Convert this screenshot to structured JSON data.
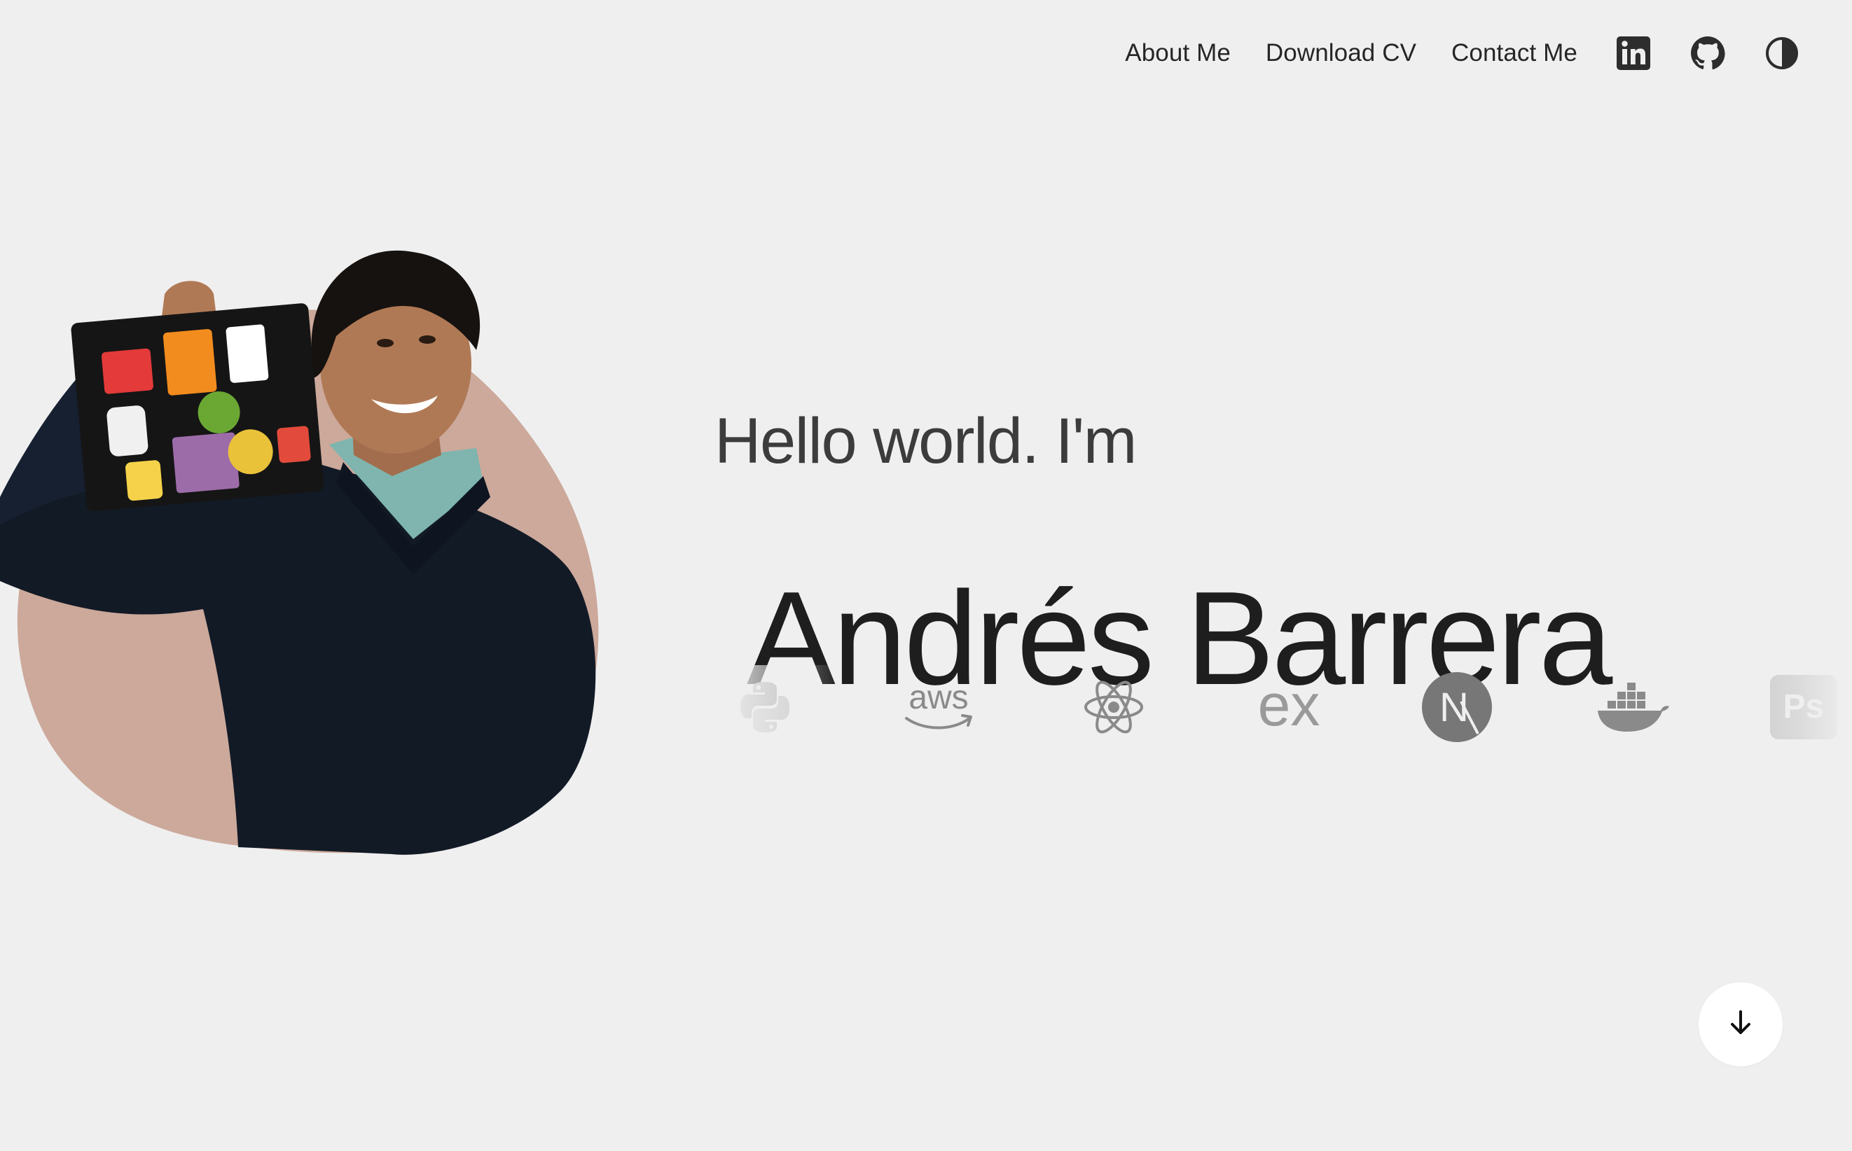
{
  "nav": {
    "links": [
      {
        "label": "About Me"
      },
      {
        "label": "Download CV"
      },
      {
        "label": "Contact Me"
      }
    ],
    "icons": [
      "linkedin-icon",
      "github-icon",
      "theme-toggle-icon"
    ]
  },
  "hero": {
    "greeting": "Hello world. I'm",
    "name": "Andrés Barrera",
    "blob_color": "#cca99b",
    "sweater_color": "#121a26",
    "shirt_color": "#7fb5ae"
  },
  "tech": {
    "items": [
      "python-icon",
      "aws-icon",
      "react-icon",
      "express-icon",
      "nextjs-icon",
      "docker-icon",
      "photoshop-icon"
    ],
    "aws_label": "aws",
    "express_label": "ex",
    "next_label": "N",
    "ps_label": "Ps",
    "icon_color": "#8a8a8a"
  },
  "scroll": {
    "icon": "arrow-down-icon"
  },
  "colors": {
    "background": "#efefef",
    "text": "#1e1e1e"
  }
}
